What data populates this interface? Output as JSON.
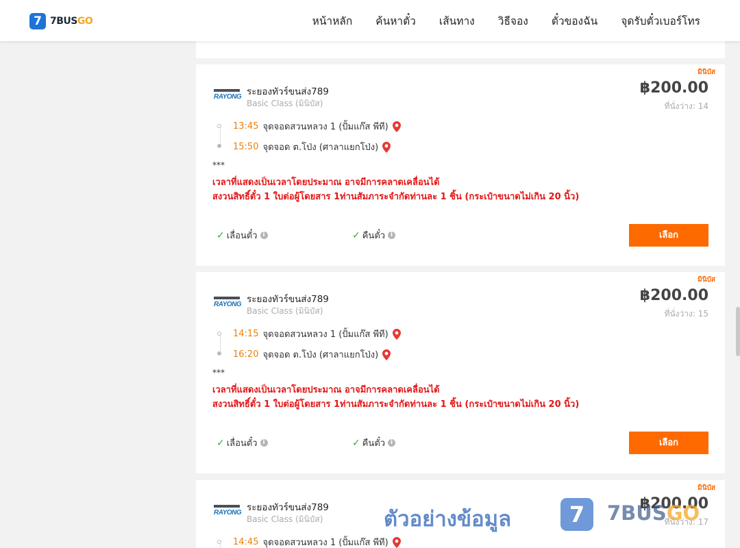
{
  "header": {
    "logo_digit": "7",
    "logo_text_a": "7BUS",
    "logo_text_b": "GO",
    "nav": [
      "หน้าหลัก",
      "ค้นหาตั๋ว",
      "เส้นทาง",
      "วิธีจอง",
      "ตั๋วของฉัน",
      "จุดรับตั๋วเบอร์โทร"
    ]
  },
  "trips": [
    {
      "bus_type": "มินิบัส",
      "operator_logo": "RAYONG",
      "operator_name": "ระยองทัวร์ขนส่ง789",
      "class": "Basic Class (มินิบัส)",
      "price": "฿200.00",
      "seats": "ที่นั่งว่าง: 14",
      "depart_time": "13:45",
      "depart_place": "จุดจอดสวนหลวง 1 (ปั้มแก๊ส พีที)",
      "arrive_time": "15:50",
      "arrive_place": "จุดจอด ต.โป่ง (ศาลาแยกโป่ง)",
      "note_stars": "***",
      "note_line1": "เวลาที่แสดงเป็นเวลาโดยประมาณ อาจมีการคลาดเคลื่อนได้",
      "note_line2": "สงวนสิทธิ์ตั๋ว 1 ใบต่อผู้โดยสาร 1ท่านสัมภาระจำกัดท่านละ 1 ชิ้น (กระเป๋าขนาดไม่เกิน 20 นิ้ว)",
      "feature1": "เลื่อนตั๋ว",
      "feature2": "คืนตั๋ว",
      "select_label": "เลือก"
    },
    {
      "bus_type": "มินิบัส",
      "operator_logo": "RAYONG",
      "operator_name": "ระยองทัวร์ขนส่ง789",
      "class": "Basic Class (มินิบัส)",
      "price": "฿200.00",
      "seats": "ที่นั่งว่าง: 15",
      "depart_time": "14:15",
      "depart_place": "จุดจอดสวนหลวง 1 (ปั้มแก๊ส พีที)",
      "arrive_time": "16:20",
      "arrive_place": "จุดจอด ต.โป่ง (ศาลาแยกโป่ง)",
      "note_stars": "***",
      "note_line1": "เวลาที่แสดงเป็นเวลาโดยประมาณ อาจมีการคลาดเคลื่อนได้",
      "note_line2": "สงวนสิทธิ์ตั๋ว 1 ใบต่อผู้โดยสาร 1ท่านสัมภาระจำกัดท่านละ 1 ชิ้น (กระเป๋าขนาดไม่เกิน 20 นิ้ว)",
      "feature1": "เลื่อนตั๋ว",
      "feature2": "คืนตั๋ว",
      "select_label": "เลือก"
    },
    {
      "bus_type": "มินิบัส",
      "operator_logo": "RAYONG",
      "operator_name": "ระยองทัวร์ขนส่ง789",
      "class": "Basic Class (มินิบัส)",
      "price": "฿200.00",
      "seats": "ที่นั่งว่าง: 17",
      "depart_time": "14:45",
      "depart_place": "จุดจอดสวนหลวง 1 (ปั้มแก๊ส พีที)"
    }
  ],
  "watermark": {
    "text": "ตัวอย่างข้อมูล",
    "logo_digit": "7",
    "brand_a": "7BUS",
    "brand_b": "GO"
  },
  "colors": {
    "accent": "#ff6a00",
    "time": "#e8820c",
    "notice": "#e51515",
    "check": "#2eaa4a",
    "brand_blue": "#1e73d8"
  }
}
